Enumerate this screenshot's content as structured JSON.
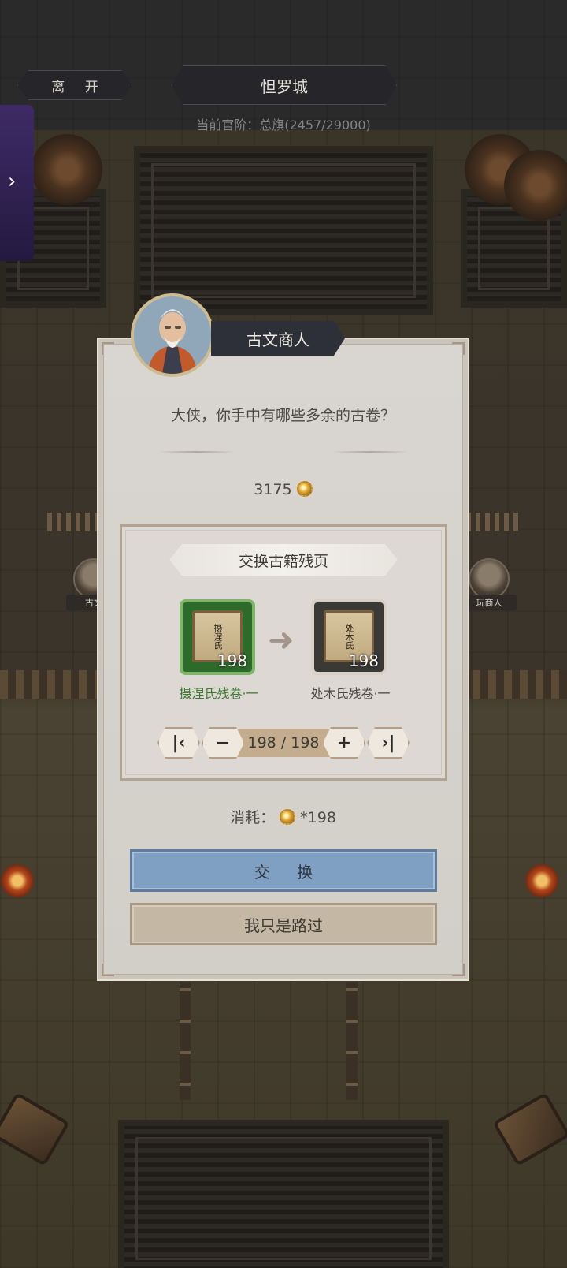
{
  "header": {
    "leave_label": "离 开",
    "city_name": "怛罗城",
    "rank_text": "当前官阶：总旗(2457/29000)"
  },
  "side_tab": {
    "icon": "chevron-right-icon",
    "glyph": "›"
  },
  "background_npcs": [
    {
      "name": "古文"
    },
    {
      "name": "玩商人"
    }
  ],
  "dialog": {
    "npc_name": "古文商人",
    "question": "大侠，你手中有哪些多余的古卷？",
    "balance": "3175",
    "exchange_panel": {
      "title": "交换古籍残页",
      "source_item": {
        "name": "摄涅氏残卷·一",
        "scroll_text": "摄涅氏",
        "quantity": "198"
      },
      "target_item": {
        "name": "处木氏残卷·一",
        "scroll_text": "处木氏",
        "quantity": "198"
      },
      "stepper": {
        "first_glyph": "|‹",
        "minus_glyph": "−",
        "plus_glyph": "+",
        "last_glyph": "›|",
        "count_text": "198 / 198"
      }
    },
    "cost_label": "消耗：",
    "cost_value": "*198",
    "exchange_button": "交 换",
    "pass_button": "我只是路过"
  },
  "colors": {
    "exchange_button": "#7f9fc3",
    "source_slot": "#2d6b2a",
    "source_name": "#3f7a33",
    "side_tab": "#3e2a66"
  }
}
